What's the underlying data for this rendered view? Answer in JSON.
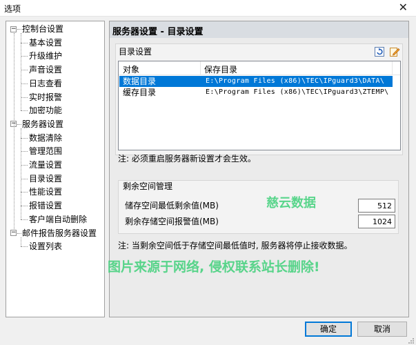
{
  "window": {
    "title": "选项",
    "close_glyph": "✕"
  },
  "tree": {
    "items": [
      {
        "label": "控制台设置",
        "level": 0,
        "expanded": true
      },
      {
        "label": "基本设置",
        "level": 1
      },
      {
        "label": "升级维护",
        "level": 1
      },
      {
        "label": "声音设置",
        "level": 1
      },
      {
        "label": "日志查看",
        "level": 1
      },
      {
        "label": "实时报警",
        "level": 1
      },
      {
        "label": "加密功能",
        "level": 1
      },
      {
        "label": "服务器设置",
        "level": 0,
        "expanded": true
      },
      {
        "label": "数据清除",
        "level": 1
      },
      {
        "label": "管理范围",
        "level": 1
      },
      {
        "label": "流量设置",
        "level": 1
      },
      {
        "label": "目录设置",
        "level": 1
      },
      {
        "label": "性能设置",
        "level": 1
      },
      {
        "label": "报错设置",
        "level": 1
      },
      {
        "label": "客户端自动删除",
        "level": 1
      },
      {
        "label": "邮件报告服务器设置",
        "level": 0,
        "expanded": true
      },
      {
        "label": "设置列表",
        "level": 1
      }
    ]
  },
  "panel": {
    "header": "服务器设置 - 目录设置",
    "dir_group": {
      "label": "目录设置",
      "icons": [
        "refresh-icon",
        "edit-icon"
      ],
      "columns": [
        "对象",
        "保存目录"
      ],
      "rows": [
        {
          "object": "数据目录",
          "path": "E:\\Program Files (x86)\\TEC\\IPguard3\\DATA\\",
          "selected": true
        },
        {
          "object": "缓存目录",
          "path": "E:\\Program Files (x86)\\TEC\\IPguard3\\ZTEMP\\",
          "selected": false
        }
      ]
    },
    "note1": "注: 必须重启服务器新设置才会生效。",
    "space_group": {
      "label": "剩余空间管理",
      "min_label": "储存空间最低剩余值(MB)",
      "min_value": "512",
      "alarm_label": "剩余存储空间报警值(MB)",
      "alarm_value": "1024"
    },
    "note2": "注: 当剩余空间低于存储空间最低值时, 服务器将停止接收数据。"
  },
  "watermarks": {
    "brand": "慈云数据",
    "notice": "图片来源于网络, 侵权联系站长删除!"
  },
  "buttons": {
    "ok": "确定",
    "cancel": "取消"
  }
}
